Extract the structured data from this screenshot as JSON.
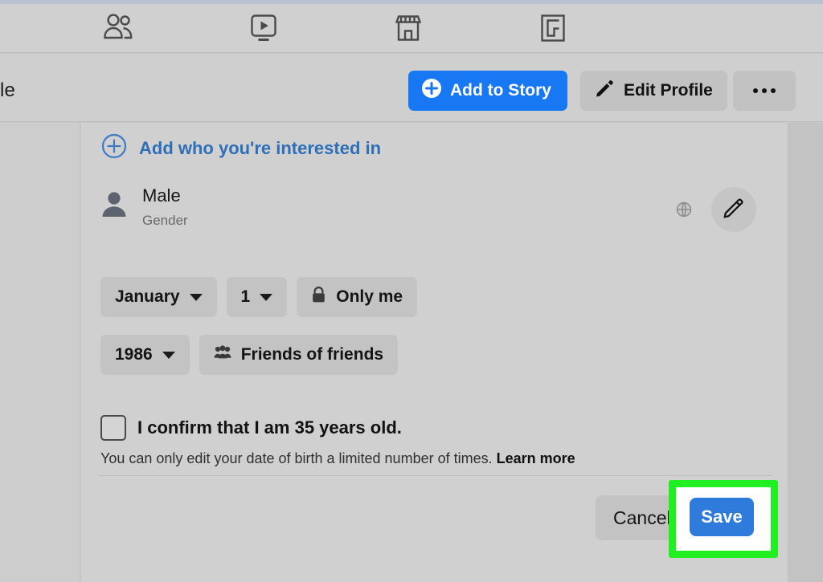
{
  "topnav": {
    "items": [
      {
        "id": "friends",
        "icon": "friends-icon",
        "label": "Friends"
      },
      {
        "id": "watch",
        "icon": "watch-icon",
        "label": "Watch"
      },
      {
        "id": "marketplace",
        "icon": "marketplace-icon",
        "label": "Marketplace"
      },
      {
        "id": "groups",
        "icon": "gaming-icon",
        "label": "Gaming"
      }
    ]
  },
  "actionbar": {
    "profile_name_partial": "le",
    "add_to_story_label": "Add to Story",
    "edit_profile_label": "Edit Profile",
    "more_label": "•••"
  },
  "main": {
    "interested_link_label": "Add who you're interested in",
    "gender": {
      "value": "Male",
      "sub_label": "Gender",
      "privacy_icon": "globe-icon",
      "edit_icon": "pencil-icon"
    },
    "birthday": {
      "month": "January",
      "day": "1",
      "date_privacy": "Only me",
      "date_privacy_icon": "lock-icon",
      "year": "1986",
      "year_privacy": "Friends of friends",
      "year_privacy_icon": "friends-group-icon"
    },
    "confirm": {
      "checked": false,
      "label": "I confirm that I am 35 years old."
    },
    "disclaimer": {
      "text": "You can only edit your date of birth a limited number of times.",
      "link_label": "Learn more"
    },
    "footer": {
      "cancel_label": "Cancel",
      "save_label": "Save"
    }
  },
  "colors": {
    "facebook_blue": "#1877f2",
    "save_blue": "#2f7bdb",
    "link_blue": "#2f6fb8",
    "highlight_green": "#22ef22",
    "panel_bg": "#d0d0d0"
  }
}
